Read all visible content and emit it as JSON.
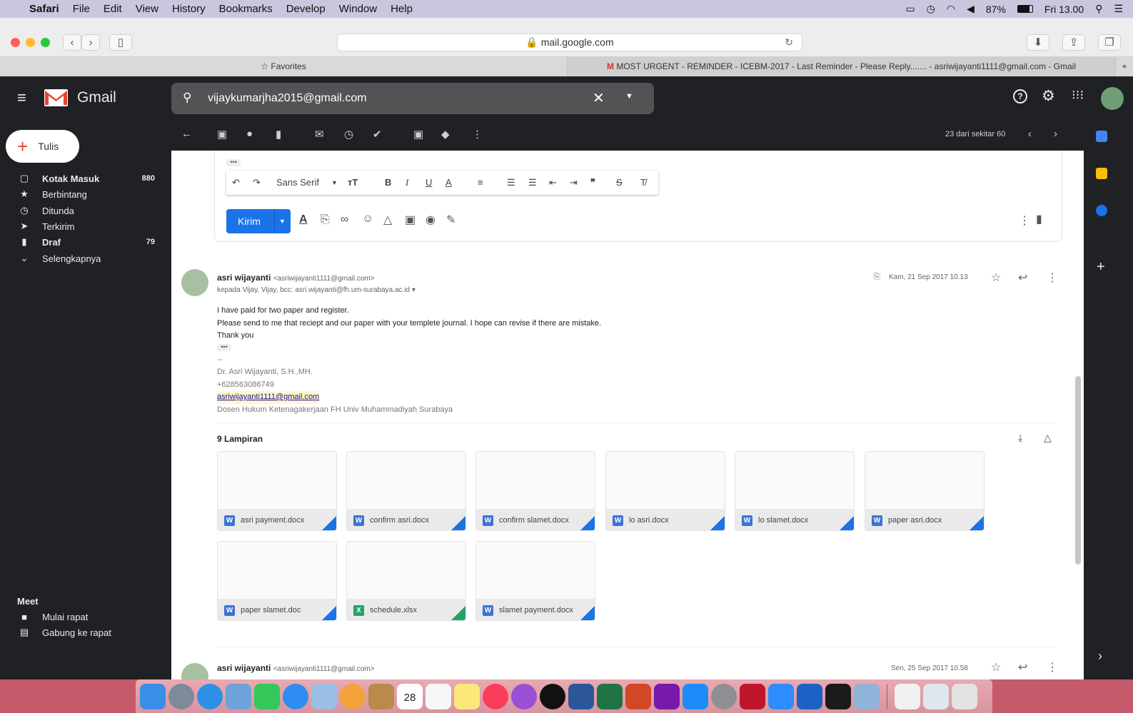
{
  "menubar": {
    "app": "Safari",
    "items": [
      "File",
      "Edit",
      "View",
      "History",
      "Bookmarks",
      "Develop",
      "Window",
      "Help"
    ],
    "battery": "87%",
    "clock": "Fri 13.00"
  },
  "browser": {
    "url": "mail.google.com",
    "tabs": {
      "favorites": "Favorites",
      "active": "MOST URGENT - REMINDER - ICEBM-2017 - Last Reminder - Please Reply....... - asriwijayanti1111@gmail.com - Gmail"
    }
  },
  "gmail": {
    "brand": "Gmail",
    "search": "vijaykumarjha2015@gmail.com",
    "compose": "Tulis",
    "nav": [
      {
        "label": "Kotak Masuk",
        "count": "880",
        "bold": true,
        "icon": "inbox-icon"
      },
      {
        "label": "Berbintang",
        "count": "",
        "icon": "star-icon"
      },
      {
        "label": "Ditunda",
        "count": "",
        "icon": "clock-icon"
      },
      {
        "label": "Terkirim",
        "count": "",
        "icon": "send-icon"
      },
      {
        "label": "Draf",
        "count": "79",
        "bold": true,
        "icon": "draft-icon"
      },
      {
        "label": "Selengkapnya",
        "count": "",
        "icon": "chevron-down-icon"
      }
    ],
    "meet": {
      "title": "Meet",
      "new": "Mulai rapat",
      "join": "Gabung ke rapat"
    },
    "pager": "23 dari sekitar 60",
    "editor": {
      "font": "Sans Serif",
      "send": "Kirim"
    },
    "message": {
      "sender": "asri wijayanti",
      "email": "<asriwijayanti1111@gmail.com>",
      "to": "kepada Vijay, Vijay, bcc: asri.wijayanti@fh.um-surabaya.ac.id",
      "date": "Kam, 21 Sep 2017 10.13",
      "body": [
        "I have paid for two paper and register.",
        "Please send to me that reciept and our paper with your templete journal. I hope can revise if there are mistake.",
        "Thank you"
      ],
      "sig": {
        "dash": "--",
        "name": "Dr. Asri Wijayanti, S.H.,MH.",
        "phone": "+628563086749",
        "email": "asriwijayanti1111@gmail.com",
        "title": "Dosen Hukum Ketenagakerjaan FH Univ Muhammadiyah Surabaya"
      }
    },
    "attachments_title": "9 Lampiran",
    "attachments": [
      {
        "name": "asri payment.docx",
        "type": "W"
      },
      {
        "name": "confirm asri.docx",
        "type": "W"
      },
      {
        "name": "confirm slamet.docx",
        "type": "W"
      },
      {
        "name": "lo asri.docx",
        "type": "W"
      },
      {
        "name": "lo slamet.docx",
        "type": "W"
      },
      {
        "name": "paper asri.docx",
        "type": "W"
      },
      {
        "name": "paper slamet.doc",
        "type": "W"
      },
      {
        "name": "schedule.xlsx",
        "type": "X"
      },
      {
        "name": "slamet payment.docx",
        "type": "W"
      }
    ],
    "next": {
      "sender": "asri wijayanti",
      "email": "<asriwijayanti1111@gmail.com>",
      "date": "Sen, 25 Sep 2017 10.58"
    }
  },
  "dock": {
    "calendar_day": "28"
  }
}
